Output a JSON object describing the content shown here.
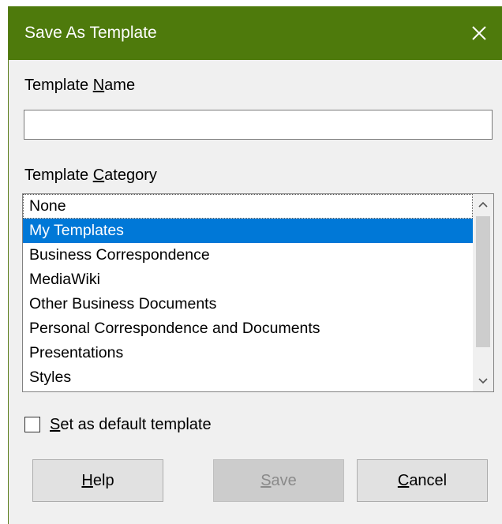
{
  "window": {
    "title": "Save As Template",
    "title_bar_color": "#4e7a0c",
    "close_icon": "close-icon"
  },
  "template_name": {
    "label_before": "Template ",
    "label_mnemonic": "N",
    "label_after": "ame",
    "value": "",
    "placeholder": ""
  },
  "template_category": {
    "label_before": "Template ",
    "label_mnemonic": "C",
    "label_after": "ategory",
    "items": [
      "None",
      "My Templates",
      "Business Correspondence",
      "MediaWiki",
      "Other Business Documents",
      "Personal Correspondence and Documents",
      "Presentations",
      "Styles"
    ],
    "selected": "My Templates",
    "selection_color": "#0078d7"
  },
  "default_checkbox": {
    "label_mnemonic": "S",
    "label_after": "et as default template",
    "checked": false
  },
  "buttons": {
    "help": {
      "mnemonic": "H",
      "rest": "elp"
    },
    "save": {
      "mnemonic": "S",
      "rest": "ave",
      "disabled": true
    },
    "cancel": {
      "mnemonic": "C",
      "rest": "ancel"
    }
  }
}
